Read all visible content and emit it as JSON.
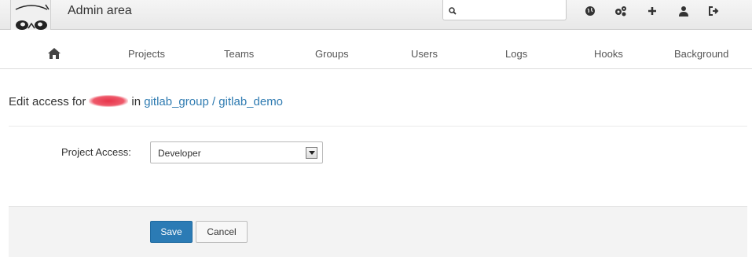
{
  "header": {
    "title": "Admin area",
    "search_placeholder": "",
    "icons": [
      "globe-icon",
      "settings-gears-icon",
      "plus-icon",
      "user-icon",
      "sign-out-icon"
    ]
  },
  "nav": {
    "home_icon": "home-icon",
    "items": [
      "Projects",
      "Teams",
      "Groups",
      "Users",
      "Logs",
      "Hooks",
      "Background"
    ]
  },
  "page": {
    "heading_prefix": "Edit access for",
    "heading_in": "in",
    "project_path": "gitlab_group / gitlab_demo"
  },
  "form": {
    "label": "Project Access:",
    "selected_value": "Developer"
  },
  "actions": {
    "save_label": "Save",
    "cancel_label": "Cancel"
  },
  "colors": {
    "link": "#2f7bb1",
    "primary_button": "#2b7bb5"
  }
}
